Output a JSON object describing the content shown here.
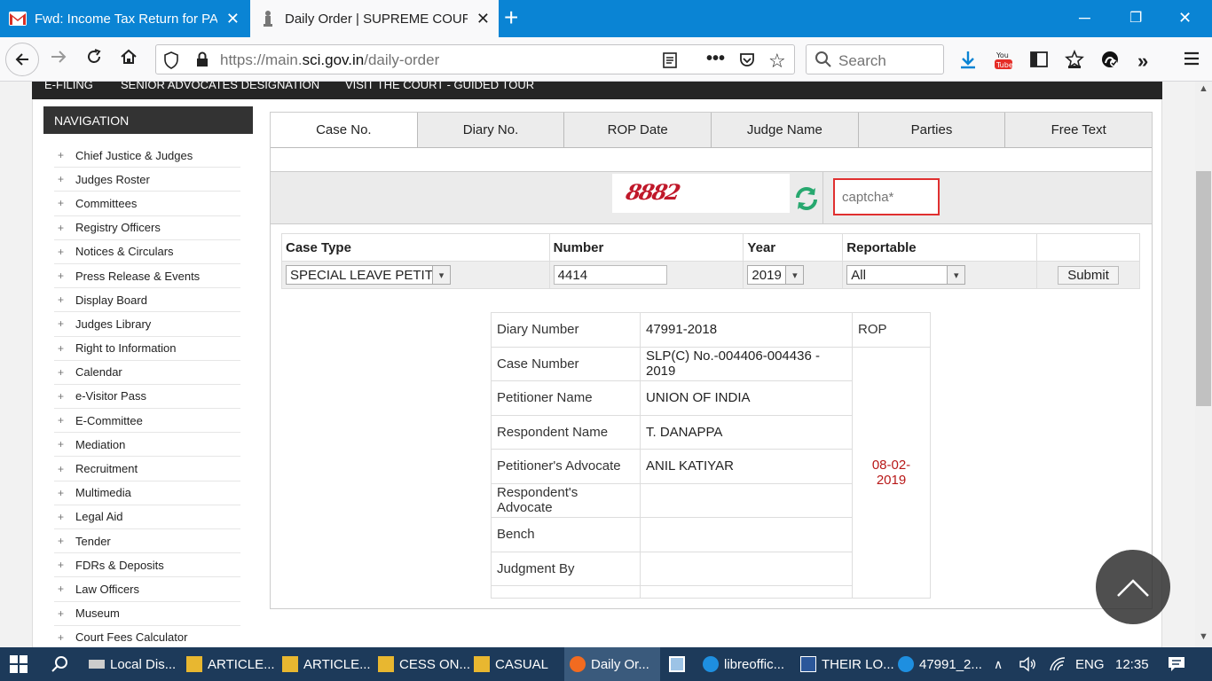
{
  "browser": {
    "tabs": [
      {
        "title": "Fwd: Income Tax Return for PAN",
        "active": false
      },
      {
        "title": "Daily Order | SUPREME COURT",
        "active": true
      }
    ],
    "url_prefix": "https://main.",
    "url_domain": "sci.gov.in",
    "url_path": "/daily-order",
    "search_placeholder": "Search"
  },
  "top_menu": [
    "E-FILING",
    "SENIOR ADVOCATES DESIGNATION",
    "VISIT THE COURT - GUIDED TOUR"
  ],
  "navigation": {
    "heading": "NAVIGATION",
    "items": [
      "Chief Justice & Judges",
      "Judges Roster",
      "Committees",
      "Registry Officers",
      "Notices & Circulars",
      "Press Release & Events",
      "Display Board",
      "Judges Library",
      "Right to Information",
      "Calendar",
      "e-Visitor Pass",
      "E-Committee",
      "Mediation",
      "Recruitment",
      "Multimedia",
      "Legal Aid",
      "Tender",
      "FDRs & Deposits",
      "Law Officers",
      "Museum",
      "Court Fees Calculator"
    ]
  },
  "search_tabs": [
    "Case No.",
    "Diary No.",
    "ROP Date",
    "Judge Name",
    "Parties",
    "Free Text"
  ],
  "captcha": {
    "image_text": "8882",
    "placeholder": "captcha*"
  },
  "form": {
    "headers": {
      "case_type": "Case Type",
      "number": "Number",
      "year": "Year",
      "reportable": "Reportable"
    },
    "case_type": "SPECIAL LEAVE PETITI",
    "number": "4414",
    "year": "2019",
    "reportable": "All",
    "submit": "Submit"
  },
  "result": {
    "rows": [
      {
        "label": "Diary Number",
        "value": "47991-2018"
      },
      {
        "label": "Case Number",
        "value": "SLP(C) No.-004406-004436 - 2019"
      },
      {
        "label": "Petitioner Name",
        "value": "UNION OF INDIA"
      },
      {
        "label": "Respondent Name",
        "value": "T. DANAPPA"
      },
      {
        "label": "Petitioner's Advocate",
        "value": "ANIL KATIYAR"
      },
      {
        "label": "Respondent's Advocate",
        "value": ""
      },
      {
        "label": "Bench",
        "value": ""
      },
      {
        "label": "Judgment By",
        "value": ""
      }
    ],
    "rop_header": "ROP",
    "rop_date": "08-02-2019"
  },
  "taskbar": {
    "items": [
      "Local Dis...",
      "ARTICLE...",
      "ARTICLE...",
      "CESS ON...",
      "CASUAL",
      "Daily Or...",
      "",
      "libreoffic...",
      "THEIR LO...",
      "47991_2..."
    ],
    "language": "ENG",
    "time": "12:35"
  },
  "colors": {
    "tabbar": "#0a84d4",
    "taskbar": "#1d3a5a",
    "rop_date": "#b81818",
    "captcha_border": "#e03030"
  }
}
